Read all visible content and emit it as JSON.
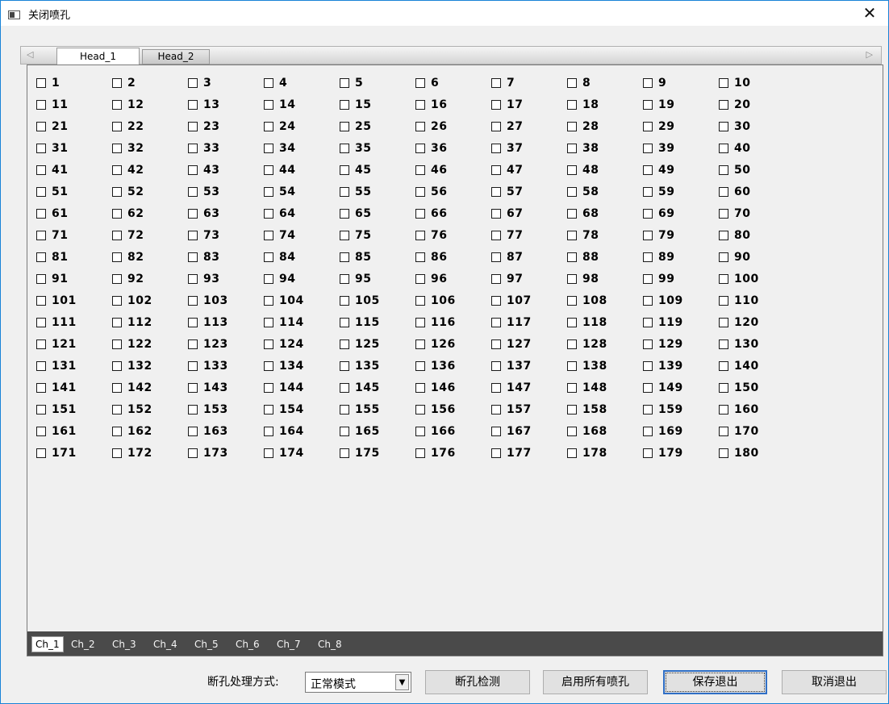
{
  "window": {
    "title": "关闭喷孔",
    "close_glyph": "✕"
  },
  "heads": {
    "left_arrow": "◁",
    "right_arrow": "▷",
    "tabs": [
      {
        "label": "Head_1",
        "active": true
      },
      {
        "label": "Head_2",
        "active": false
      }
    ]
  },
  "nozzles": {
    "count": 180,
    "columns": 10,
    "labels": [
      "1",
      "2",
      "3",
      "4",
      "5",
      "6",
      "7",
      "8",
      "9",
      "10",
      "11",
      "12",
      "13",
      "14",
      "15",
      "16",
      "17",
      "18",
      "19",
      "20",
      "21",
      "22",
      "23",
      "24",
      "25",
      "26",
      "27",
      "28",
      "29",
      "30",
      "31",
      "32",
      "33",
      "34",
      "35",
      "36",
      "37",
      "38",
      "39",
      "40",
      "41",
      "42",
      "43",
      "44",
      "45",
      "46",
      "47",
      "48",
      "49",
      "50",
      "51",
      "52",
      "53",
      "54",
      "55",
      "56",
      "57",
      "58",
      "59",
      "60",
      "61",
      "62",
      "63",
      "64",
      "65",
      "66",
      "67",
      "68",
      "69",
      "70",
      "71",
      "72",
      "73",
      "74",
      "75",
      "76",
      "77",
      "78",
      "79",
      "80",
      "81",
      "82",
      "83",
      "84",
      "85",
      "86",
      "87",
      "88",
      "89",
      "90",
      "91",
      "92",
      "93",
      "94",
      "95",
      "96",
      "97",
      "98",
      "99",
      "100",
      "101",
      "102",
      "103",
      "104",
      "105",
      "106",
      "107",
      "108",
      "109",
      "110",
      "111",
      "112",
      "113",
      "114",
      "115",
      "116",
      "117",
      "118",
      "119",
      "120",
      "121",
      "122",
      "123",
      "124",
      "125",
      "126",
      "127",
      "128",
      "129",
      "130",
      "131",
      "132",
      "133",
      "134",
      "135",
      "136",
      "137",
      "138",
      "139",
      "140",
      "141",
      "142",
      "143",
      "144",
      "145",
      "146",
      "147",
      "148",
      "149",
      "150",
      "151",
      "152",
      "153",
      "154",
      "155",
      "156",
      "157",
      "158",
      "159",
      "160",
      "161",
      "162",
      "163",
      "164",
      "165",
      "166",
      "167",
      "168",
      "169",
      "170",
      "171",
      "172",
      "173",
      "174",
      "175",
      "176",
      "177",
      "178",
      "179",
      "180"
    ],
    "checked": []
  },
  "channels": {
    "tabs": [
      {
        "label": "Ch_1",
        "active": true
      },
      {
        "label": "Ch_2",
        "active": false
      },
      {
        "label": "Ch_3",
        "active": false
      },
      {
        "label": "Ch_4",
        "active": false
      },
      {
        "label": "Ch_5",
        "active": false
      },
      {
        "label": "Ch_6",
        "active": false
      },
      {
        "label": "Ch_7",
        "active": false
      },
      {
        "label": "Ch_8",
        "active": false
      }
    ]
  },
  "footer": {
    "mode_label": "断孔处理方式:",
    "mode_value": "正常模式",
    "detect_button": "断孔检测",
    "enable_all_button": "启用所有喷孔",
    "save_exit_button": "保存退出",
    "cancel_exit_button": "取消退出"
  }
}
